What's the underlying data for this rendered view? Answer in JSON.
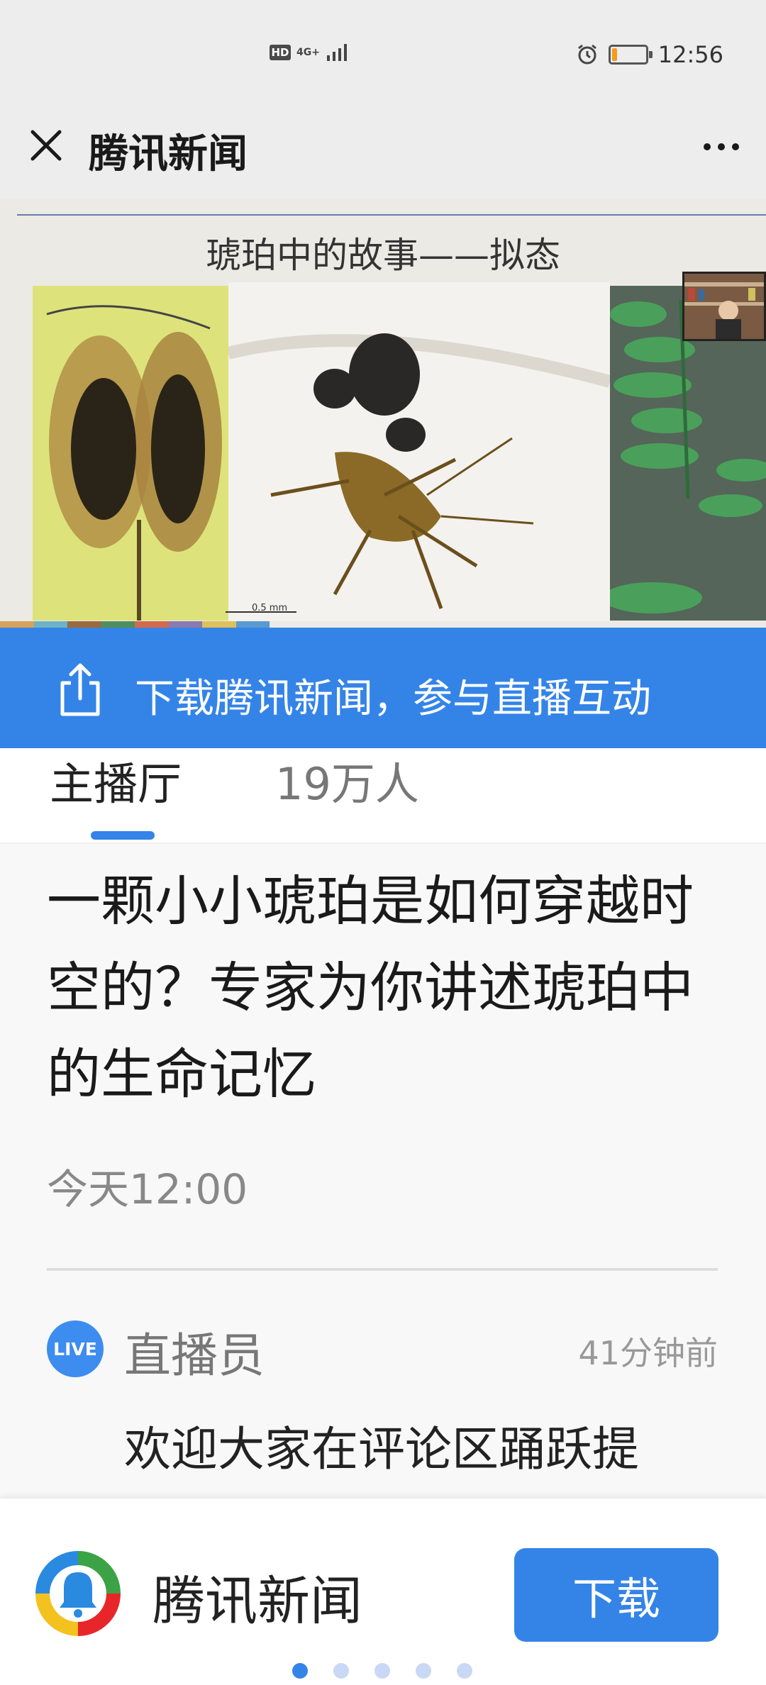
{
  "status_bar": {
    "network_badge": "HD",
    "network_type": "4G+",
    "time": "12:56",
    "battery_level": 0.15
  },
  "header": {
    "title": "腾讯新闻"
  },
  "video": {
    "slide_title": "琥珀中的故事——拟态",
    "scale_label": "0.5 mm"
  },
  "banner": {
    "text": "下载腾讯新闻，参与直播互动"
  },
  "tabs": {
    "host_label": "主播厅",
    "viewer_count": "19万人"
  },
  "article": {
    "headline": "一颗小小琥珀是如何穿越时空的？专家为你讲述琥珀中的生命记忆",
    "time": "今天12:00"
  },
  "live_post": {
    "icon_text": "LIVE",
    "author": "直播员",
    "time_ago": "41分钟前",
    "text": "欢迎大家在评论区踊跃提"
  },
  "bottom_bar": {
    "app_name": "腾讯新闻",
    "download_label": "下载",
    "page_count": 5,
    "active_page": 1
  },
  "colors": {
    "accent": "#3484e8",
    "battery": "#f59a1e"
  }
}
